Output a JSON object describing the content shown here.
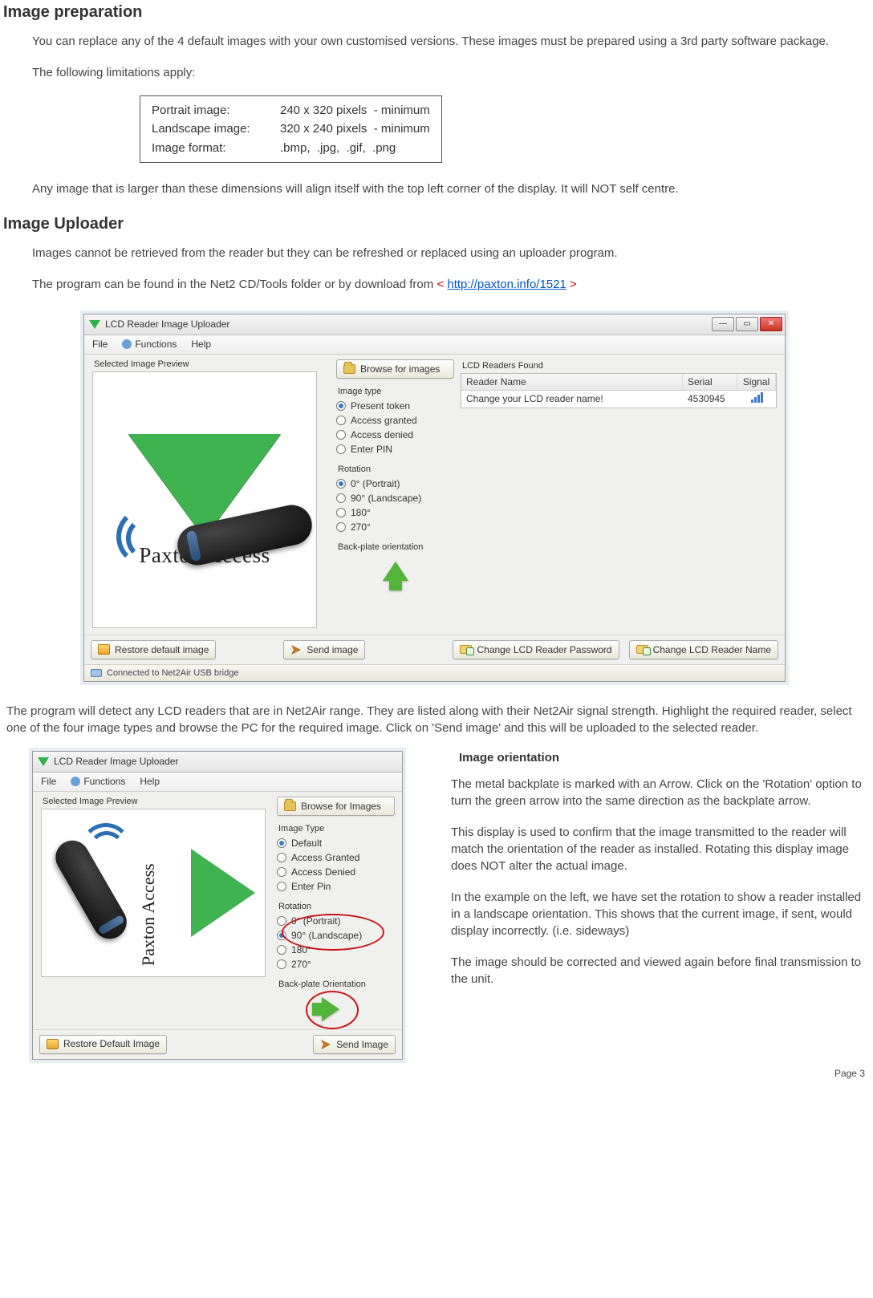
{
  "section1": {
    "heading": "Image preparation",
    "p1": "You can replace any of the 4 default images with your own customised versions. These images must be prepared using a 3rd party software package.",
    "p2": "The following limitations apply:",
    "limits": {
      "row1_label": "Portrait image:",
      "row1_val": "240 x 320 pixels  - minimum",
      "row2_label": "Landscape image:",
      "row2_val": "320 x 240 pixels  - minimum",
      "row3_label": "Image format:",
      "row3_val": ".bmp,  .jpg,  .gif,  .png"
    },
    "p3": "Any image that is larger than these dimensions will align itself with the top left corner of the display. It will NOT self centre."
  },
  "section2": {
    "heading": "Image Uploader",
    "p1": "Images cannot be retrieved from the reader but they can be refreshed or replaced using an uploader program.",
    "p2a": "The program can be found in the Net2 CD/Tools folder or by download from ",
    "p2_lt": "< ",
    "p2_link": "http://paxton.info/1521",
    "p2_gt": " >",
    "p3": "The program will detect any LCD readers that are in Net2Air range.  They are listed along with their Net2Air signal strength. Highlight the required reader, select one of the four image types and browse the PC for the required image.  Click on 'Send image' and this will be uploaded to the selected reader."
  },
  "win1": {
    "title": "LCD Reader Image Uploader",
    "menu": {
      "file": "File",
      "functions": "Functions",
      "help": "Help"
    },
    "preview_label": "Selected Image Preview",
    "paxton_text": "Paxton Access",
    "browse": "Browse for images",
    "imgtype_label": "Image type",
    "imgtype": [
      "Present token",
      "Access granted",
      "Access denied",
      "Enter PIN"
    ],
    "rot_label": "Rotation",
    "rot": [
      "0° (Portrait)",
      "90° (Landscape)",
      "180°",
      "270°"
    ],
    "backplate": "Back-plate orientation",
    "found_label": "LCD Readers Found",
    "cols": {
      "name": "Reader Name",
      "serial": "Serial",
      "signal": "Signal"
    },
    "row": {
      "name": "Change your LCD reader name!",
      "serial": "4530945"
    },
    "restore": "Restore default image",
    "send": "Send image",
    "chpwd": "Change LCD Reader Password",
    "chname": "Change LCD Reader Name",
    "status": "Connected to Net2Air USB bridge"
  },
  "win2": {
    "title": "LCD Reader Image Uploader",
    "menu": {
      "file": "File",
      "functions": "Functions",
      "help": "Help"
    },
    "preview_label": "Selected Image Preview",
    "paxton_text": "Paxton Access",
    "browse": "Browse for Images",
    "imgtype_label": "Image Type",
    "imgtype": [
      "Default",
      "Access Granted",
      "Access Denied",
      "Enter Pin"
    ],
    "rot_label": "Rotation",
    "rot": [
      "0° (Portrait)",
      "90° (Landscape)",
      "180°",
      "270°"
    ],
    "backplate": "Back-plate Orientation",
    "restore": "Restore Default Image",
    "send": "Send Image"
  },
  "orientation": {
    "heading": "Image orientation",
    "p1": "The metal backplate is marked with an Arrow.  Click on the 'Rotation' option to turn the green arrow into the same direction as the backplate arrow.",
    "p2": "This display is used to confirm that the image transmitted to the reader will match the orientation of the reader as installed.  Rotating this display image does NOT alter the actual image.",
    "p3": "In the example on the left, we have set the rotation to show a reader installed in a landscape orientation.  This shows that the current image, if sent, would display incorrectly. (i.e. sideways)",
    "p4": "The image should be corrected and viewed again before final transmission to the unit."
  },
  "page_label": "Page  3"
}
